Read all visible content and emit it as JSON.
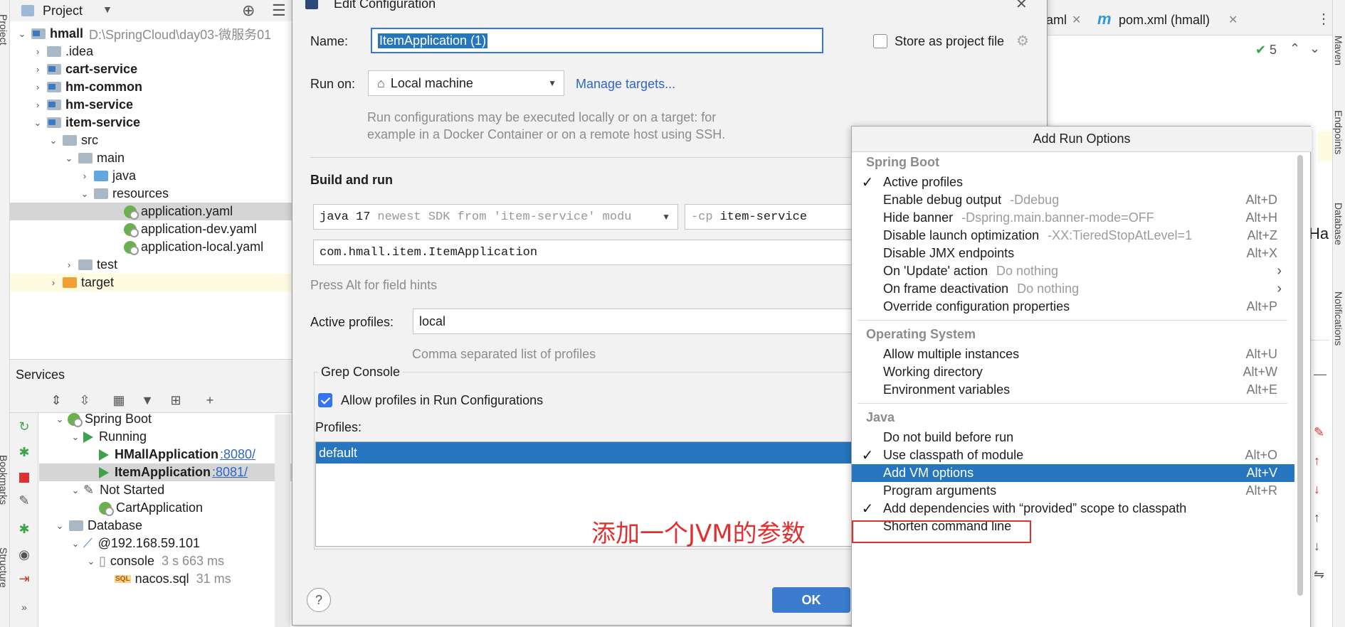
{
  "strips": {
    "left_labels": [
      "Project",
      "Bookmarks",
      "Structure"
    ],
    "right_labels": [
      "Maven",
      "Endpoints",
      "Database",
      "Notifications"
    ]
  },
  "project": {
    "title": "Project",
    "tree": [
      {
        "label": "hmall",
        "extra": "D:\\SpringCloud\\day03-微服务01",
        "bold": true,
        "indent": 0,
        "arrow": "down",
        "icon": "module"
      },
      {
        "label": ".idea",
        "indent": 1,
        "arrow": "right",
        "icon": "folder"
      },
      {
        "label": "cart-service",
        "bold": true,
        "indent": 1,
        "arrow": "right",
        "icon": "module"
      },
      {
        "label": "hm-common",
        "bold": true,
        "indent": 1,
        "arrow": "right",
        "icon": "module"
      },
      {
        "label": "hm-service",
        "bold": true,
        "indent": 1,
        "arrow": "right",
        "icon": "module"
      },
      {
        "label": "item-service",
        "bold": true,
        "indent": 1,
        "arrow": "down",
        "icon": "module"
      },
      {
        "label": "src",
        "indent": 2,
        "arrow": "down",
        "icon": "folder"
      },
      {
        "label": "main",
        "indent": 3,
        "arrow": "down",
        "icon": "folder"
      },
      {
        "label": "java",
        "indent": 4,
        "arrow": "right",
        "icon": "blue"
      },
      {
        "label": "resources",
        "indent": 4,
        "arrow": "down",
        "icon": "folder"
      },
      {
        "label": "application.yaml",
        "indent": 6,
        "arrow": "",
        "icon": "leaf",
        "selected": true
      },
      {
        "label": "application-dev.yaml",
        "indent": 6,
        "arrow": "",
        "icon": "leaf"
      },
      {
        "label": "application-local.yaml",
        "indent": 6,
        "arrow": "",
        "icon": "leaf"
      },
      {
        "label": "test",
        "indent": 3,
        "arrow": "right",
        "icon": "folder"
      },
      {
        "label": "target",
        "indent": 2,
        "arrow": "right",
        "icon": "orange",
        "yellow": true
      }
    ]
  },
  "services": {
    "title": "Services",
    "tree": [
      {
        "label": "Spring Boot",
        "indent": 1,
        "arrow": "down",
        "icon": "leaf"
      },
      {
        "label": "Running",
        "indent": 2,
        "arrow": "down",
        "icon": "play"
      },
      {
        "label": "HMallApplication",
        "port": ":8080/",
        "bold": true,
        "indent": 3,
        "arrow": "",
        "icon": "play"
      },
      {
        "label": "ItemApplication",
        "port": ":8081/",
        "bold": true,
        "indent": 3,
        "arrow": "",
        "icon": "play",
        "selected": true
      },
      {
        "label": "Not Started",
        "indent": 2,
        "arrow": "down",
        "icon": "wrench"
      },
      {
        "label": "CartApplication",
        "indent": 3,
        "arrow": "",
        "icon": "leaf"
      },
      {
        "label": "Database",
        "indent": 1,
        "arrow": "down",
        "icon": "folder"
      },
      {
        "label": "@192.168.59.101",
        "indent": 2,
        "arrow": "down",
        "icon": "db"
      },
      {
        "label": "console",
        "time": "3 s 663 ms",
        "indent": 3,
        "arrow": "down",
        "icon": "console"
      },
      {
        "label": "nacos.sql",
        "time": "31 ms",
        "indent": 4,
        "arrow": "",
        "icon": "sql"
      }
    ]
  },
  "editor": {
    "tab1": "aml",
    "tab2": "pom.xml (hmall)",
    "inspection_count": "5",
    "side_text": "Ha"
  },
  "dialog": {
    "title": "Edit Configuration",
    "name_label": "Name:",
    "name_value": "ItemApplication (1)",
    "store_label": "Store as project file",
    "run_on_label": "Run on:",
    "run_on_value": "Local machine",
    "manage_targets": "Manage targets...",
    "run_hint_1": "Run configurations may be executed locally or on a target: for",
    "run_hint_2": "example in a Docker Container or on a remote host using SSH.",
    "build_run_title": "Build and run",
    "sdk_value": "java 17",
    "sdk_hint": "newest SDK from 'item-service' modu",
    "cp_flag": "-cp",
    "cp_value": "item-service",
    "main_class": "com.hmall.item.ItemApplication",
    "field_hint": "Press Alt for field hints",
    "active_profiles_label": "Active profiles:",
    "active_profiles_value": "local",
    "profiles_hint": "Comma separated list of profiles",
    "grep_console": "Grep Console",
    "allow_profiles": "Allow profiles in Run Configurations",
    "profiles_label": "Profiles:",
    "profiles_item": "default",
    "annotation": "添加一个JVM的参数",
    "ok": "OK",
    "help": "?"
  },
  "popup": {
    "title": "Add Run Options",
    "groups": [
      {
        "name": "Spring Boot",
        "items": [
          {
            "label": "Active profiles",
            "checked": true
          },
          {
            "label": "Enable debug output",
            "hint": "-Ddebug",
            "shortcut": "Alt+D"
          },
          {
            "label": "Hide banner",
            "hint": "-Dspring.main.banner-mode=OFF",
            "shortcut": "Alt+H"
          },
          {
            "label": "Disable launch optimization",
            "hint": "-XX:TieredStopAtLevel=1",
            "shortcut": "Alt+Z"
          },
          {
            "label": "Disable JMX endpoints",
            "shortcut": "Alt+X"
          },
          {
            "label": "On 'Update' action",
            "hint": "Do nothing",
            "submenu": true
          },
          {
            "label": "On frame deactivation",
            "hint": "Do nothing",
            "submenu": true
          },
          {
            "label": "Override configuration properties",
            "shortcut": "Alt+P"
          }
        ]
      },
      {
        "name": "Operating System",
        "items": [
          {
            "label": "Allow multiple instances",
            "shortcut": "Alt+U"
          },
          {
            "label": "Working directory",
            "shortcut": "Alt+W"
          },
          {
            "label": "Environment variables",
            "shortcut": "Alt+E"
          }
        ]
      },
      {
        "name": "Java",
        "items": [
          {
            "label": "Do not build before run"
          },
          {
            "label": "Use classpath of module",
            "checked": true,
            "shortcut": "Alt+O"
          },
          {
            "label": "Add VM options",
            "shortcut": "Alt+V",
            "highlighted": true
          },
          {
            "label": "Program arguments",
            "shortcut": "Alt+R"
          },
          {
            "label": "Add dependencies with “provided” scope to classpath",
            "checked": true
          },
          {
            "label": "Shorten command line"
          }
        ]
      }
    ]
  },
  "colors": {
    "selection_blue": "#2675bf",
    "accent_red": "#e03030",
    "link_blue": "#2f65ca"
  }
}
